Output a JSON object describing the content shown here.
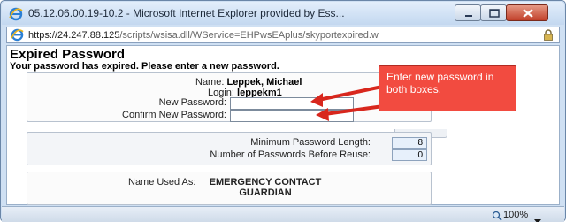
{
  "window": {
    "title": "05.12.06.00.19-10.2 - Microsoft Internet Explorer provided by Ess...",
    "url_main": "https://24.247.88.125",
    "url_path": "/scripts/wsisa.dll/WService=EHPwsEAplus/skyportexpired.w"
  },
  "page": {
    "title": "Expired Password",
    "subtitle": "Your password has expired. Please enter a new password."
  },
  "account": {
    "name_label": "Name:",
    "name_value": "Leppek, Michael",
    "login_label": "Login:",
    "login_value": "leppekm1",
    "new_password_label": "New Password:",
    "confirm_password_label": "Confirm New Password:",
    "new_password_value": "",
    "confirm_password_value": ""
  },
  "policy": {
    "min_length_label": "Minimum Password Length:",
    "min_length_value": "8",
    "reuse_label": "Number of Passwords Before Reuse:",
    "reuse_value": "0"
  },
  "name_used": {
    "label": "Name Used As:",
    "value_line1": "EMERGENCY CONTACT",
    "value_line2": "GUARDIAN"
  },
  "callout": {
    "text": "Enter new password in both boxes."
  },
  "statusbar": {
    "zoom": "100%"
  },
  "colors": {
    "callout": "#f24b40",
    "frame": "#cfe0f3",
    "close_button": "#c1402a"
  }
}
